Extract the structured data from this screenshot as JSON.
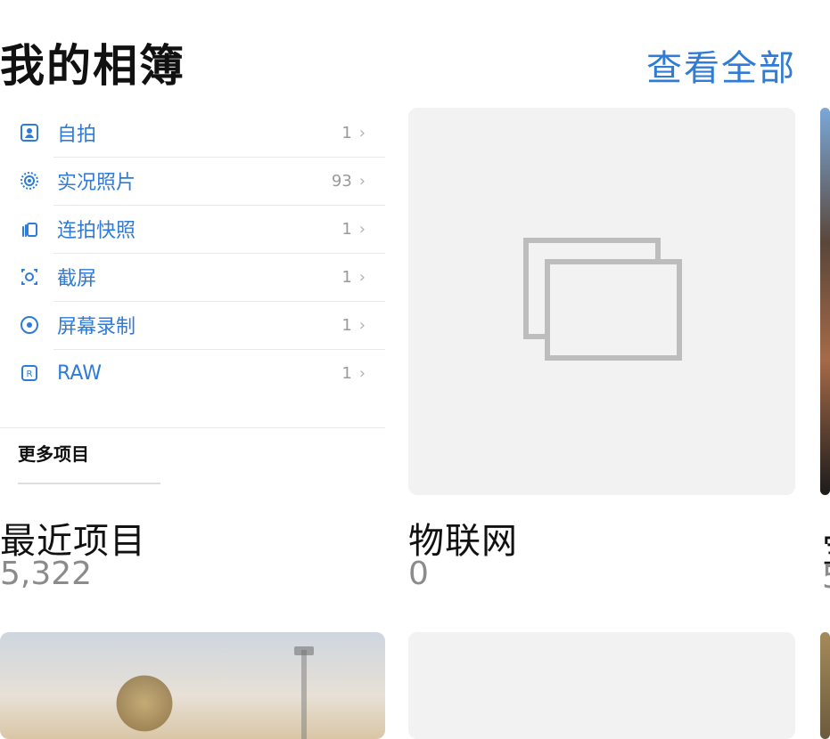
{
  "header": {
    "title": "我的相簿",
    "see_all": "查看全部"
  },
  "left_card": {
    "rows": [
      {
        "icon": "portrait-icon",
        "label": "自拍",
        "count": "1"
      },
      {
        "icon": "live-photo-icon",
        "label": "实况照片",
        "count": "93"
      },
      {
        "icon": "burst-icon",
        "label": "连拍快照",
        "count": "1"
      },
      {
        "icon": "screenshot-icon",
        "label": "截屏",
        "count": "1"
      },
      {
        "icon": "screen-recording-icon",
        "label": "屏幕录制",
        "count": "1"
      },
      {
        "icon": "raw-icon",
        "label": "RAW",
        "count": "1"
      }
    ],
    "more_title": "更多项目",
    "title": "最近项目",
    "count": "5,322"
  },
  "right_card": {
    "title": "物联网",
    "count": "0"
  },
  "colors": {
    "accent": "#2f7bd6",
    "placeholder_bg": "#f2f2f2"
  }
}
